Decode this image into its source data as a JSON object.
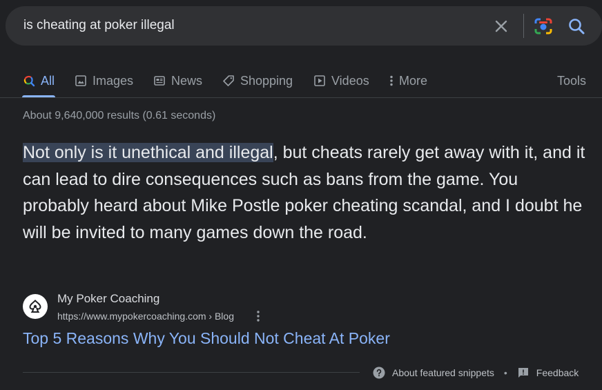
{
  "search": {
    "query": "is cheating at poker illegal"
  },
  "tabs": [
    {
      "label": "All",
      "icon": "google-multicolor-search-icon",
      "active": true
    },
    {
      "label": "Images",
      "icon": "image-icon"
    },
    {
      "label": "News",
      "icon": "newspaper-icon"
    },
    {
      "label": "Shopping",
      "icon": "tag-icon"
    },
    {
      "label": "Videos",
      "icon": "play-icon"
    },
    {
      "label": "More",
      "icon": "more-vert-icon"
    }
  ],
  "tools_label": "Tools",
  "result_stats": "About 9,640,000 results (0.61 seconds)",
  "snippet": {
    "highlight": "Not only is it unethical and illegal",
    "rest": ", but cheats rarely get away with it, and it can lead to dire consequences such as bans from the game. You probably heard about Mike Postle poker cheating scandal, and I doubt he will be invited to many games down the road."
  },
  "source": {
    "site_name": "My Poker Coaching",
    "url": "https://www.mypokercoaching.com › Blog",
    "title": "Top 5 Reasons Why You Should Not Cheat At Poker"
  },
  "footer": {
    "about_label": "About featured snippets",
    "separator": "•",
    "feedback_label": "Feedback"
  },
  "colors": {
    "background": "#202124",
    "link": "#8ab4f8",
    "highlight": "#394457",
    "text_primary": "#e8eaed",
    "text_secondary": "#9aa0a6"
  }
}
